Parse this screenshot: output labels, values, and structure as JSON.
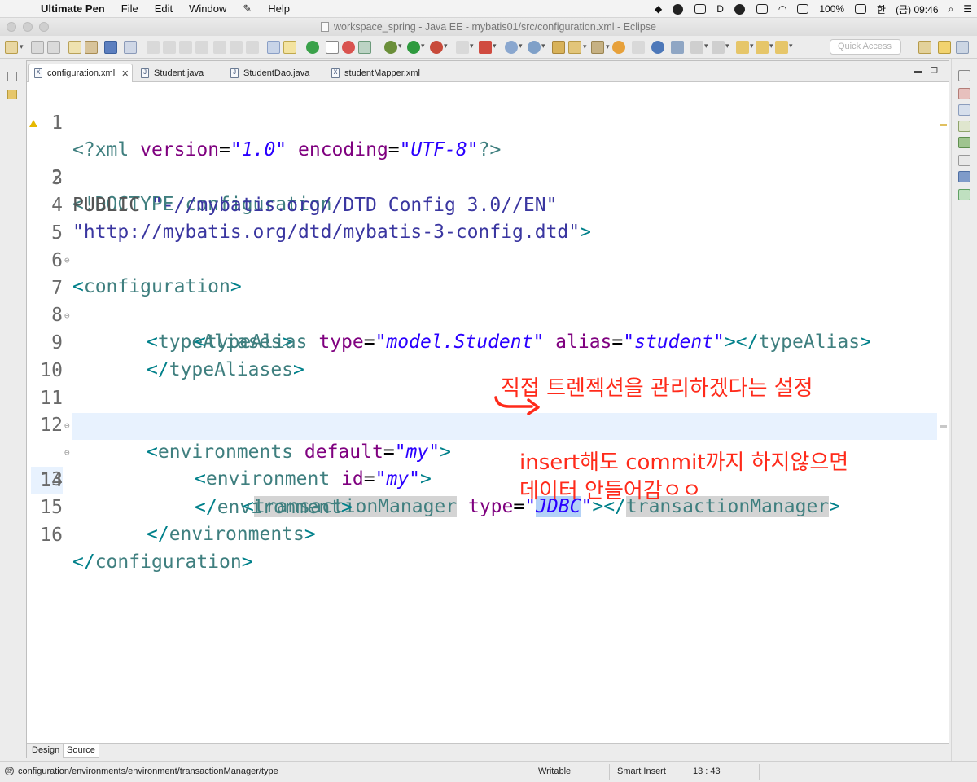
{
  "menubar": {
    "apple": "",
    "app_name": "Ultimate Pen",
    "menus": [
      "File",
      "Edit",
      "Window"
    ],
    "help": "Help",
    "battery": "100%",
    "input_lang": "한",
    "clock": "(금) 09:46"
  },
  "window": {
    "title": "workspace_spring - Java EE - mybatis01/src/configuration.xml - Eclipse"
  },
  "toolbar": {
    "quick_access_placeholder": "Quick Access"
  },
  "tabs": [
    {
      "label": "configuration.xml",
      "icon": "X",
      "active": true
    },
    {
      "label": "Student.java",
      "icon": "J"
    },
    {
      "label": "StudentDao.java",
      "icon": "J"
    },
    {
      "label": "studentMapper.xml",
      "icon": "X"
    }
  ],
  "code": {
    "lines": [
      {
        "n": "1"
      },
      {
        "n": "2"
      },
      {
        "n": "3"
      },
      {
        "n": "4"
      },
      {
        "n": "5"
      },
      {
        "n": "6"
      },
      {
        "n": "7"
      },
      {
        "n": "8"
      },
      {
        "n": "9"
      },
      {
        "n": "10"
      },
      {
        "n": "11"
      },
      {
        "n": "12"
      },
      {
        "n": "13"
      },
      {
        "n": "14"
      },
      {
        "n": "15"
      },
      {
        "n": "16"
      }
    ],
    "t": {
      "lt_pi": "<?",
      "xml": "xml",
      "version": "version",
      "eq": "=",
      "v_version": "\"1.0\"",
      "encoding": "encoding",
      "v_encoding": "\"UTF-8\"",
      "pi_end": "?>",
      "doctype": "<!DOCTYPE configuration",
      "public": "PUBLIC ",
      "public_id": "\"-//mybatis.org//DTD Config 3.0//EN\"",
      "dtd_url": "\"http://mybatis.org/dtd/mybatis-3-config.dtd\"",
      "gt": ">",
      "lt": "<",
      "lts": "</",
      "configuration": "configuration",
      "typeAliases": "typeAliases",
      "typeAlias": "typeAlias",
      "type": "type",
      "v_model": "\"model.Student\"",
      "alias": "alias",
      "v_student": "\"student\"",
      "environments": "environments",
      "default": "default",
      "v_my": "\"my\"",
      "environment": "environment",
      "id": "id",
      "transactionManager": "transactionManager",
      "q": "\"",
      "jdbc": "JDBC"
    }
  },
  "annotations": {
    "note1": "직접 트렌젝션을 관리하겠다는 설정",
    "note2_line1": "insert해도 commit까지 하지않으면",
    "note2_line2": "데이터 안들어감ㅇㅇ"
  },
  "bottom_tabs": [
    "Design",
    "Source"
  ],
  "status": {
    "path": "configuration/environments/environment/transactionManager/type",
    "mode": "Writable",
    "insert": "Smart Insert",
    "position": "13 : 43"
  },
  "colors": {
    "annotation": "#ff2a1a",
    "current_line": "#e8f2fe",
    "xml_attr": "#7f007f",
    "xml_value": "#2a00ff",
    "xml_tag": "#3f7f7f"
  }
}
